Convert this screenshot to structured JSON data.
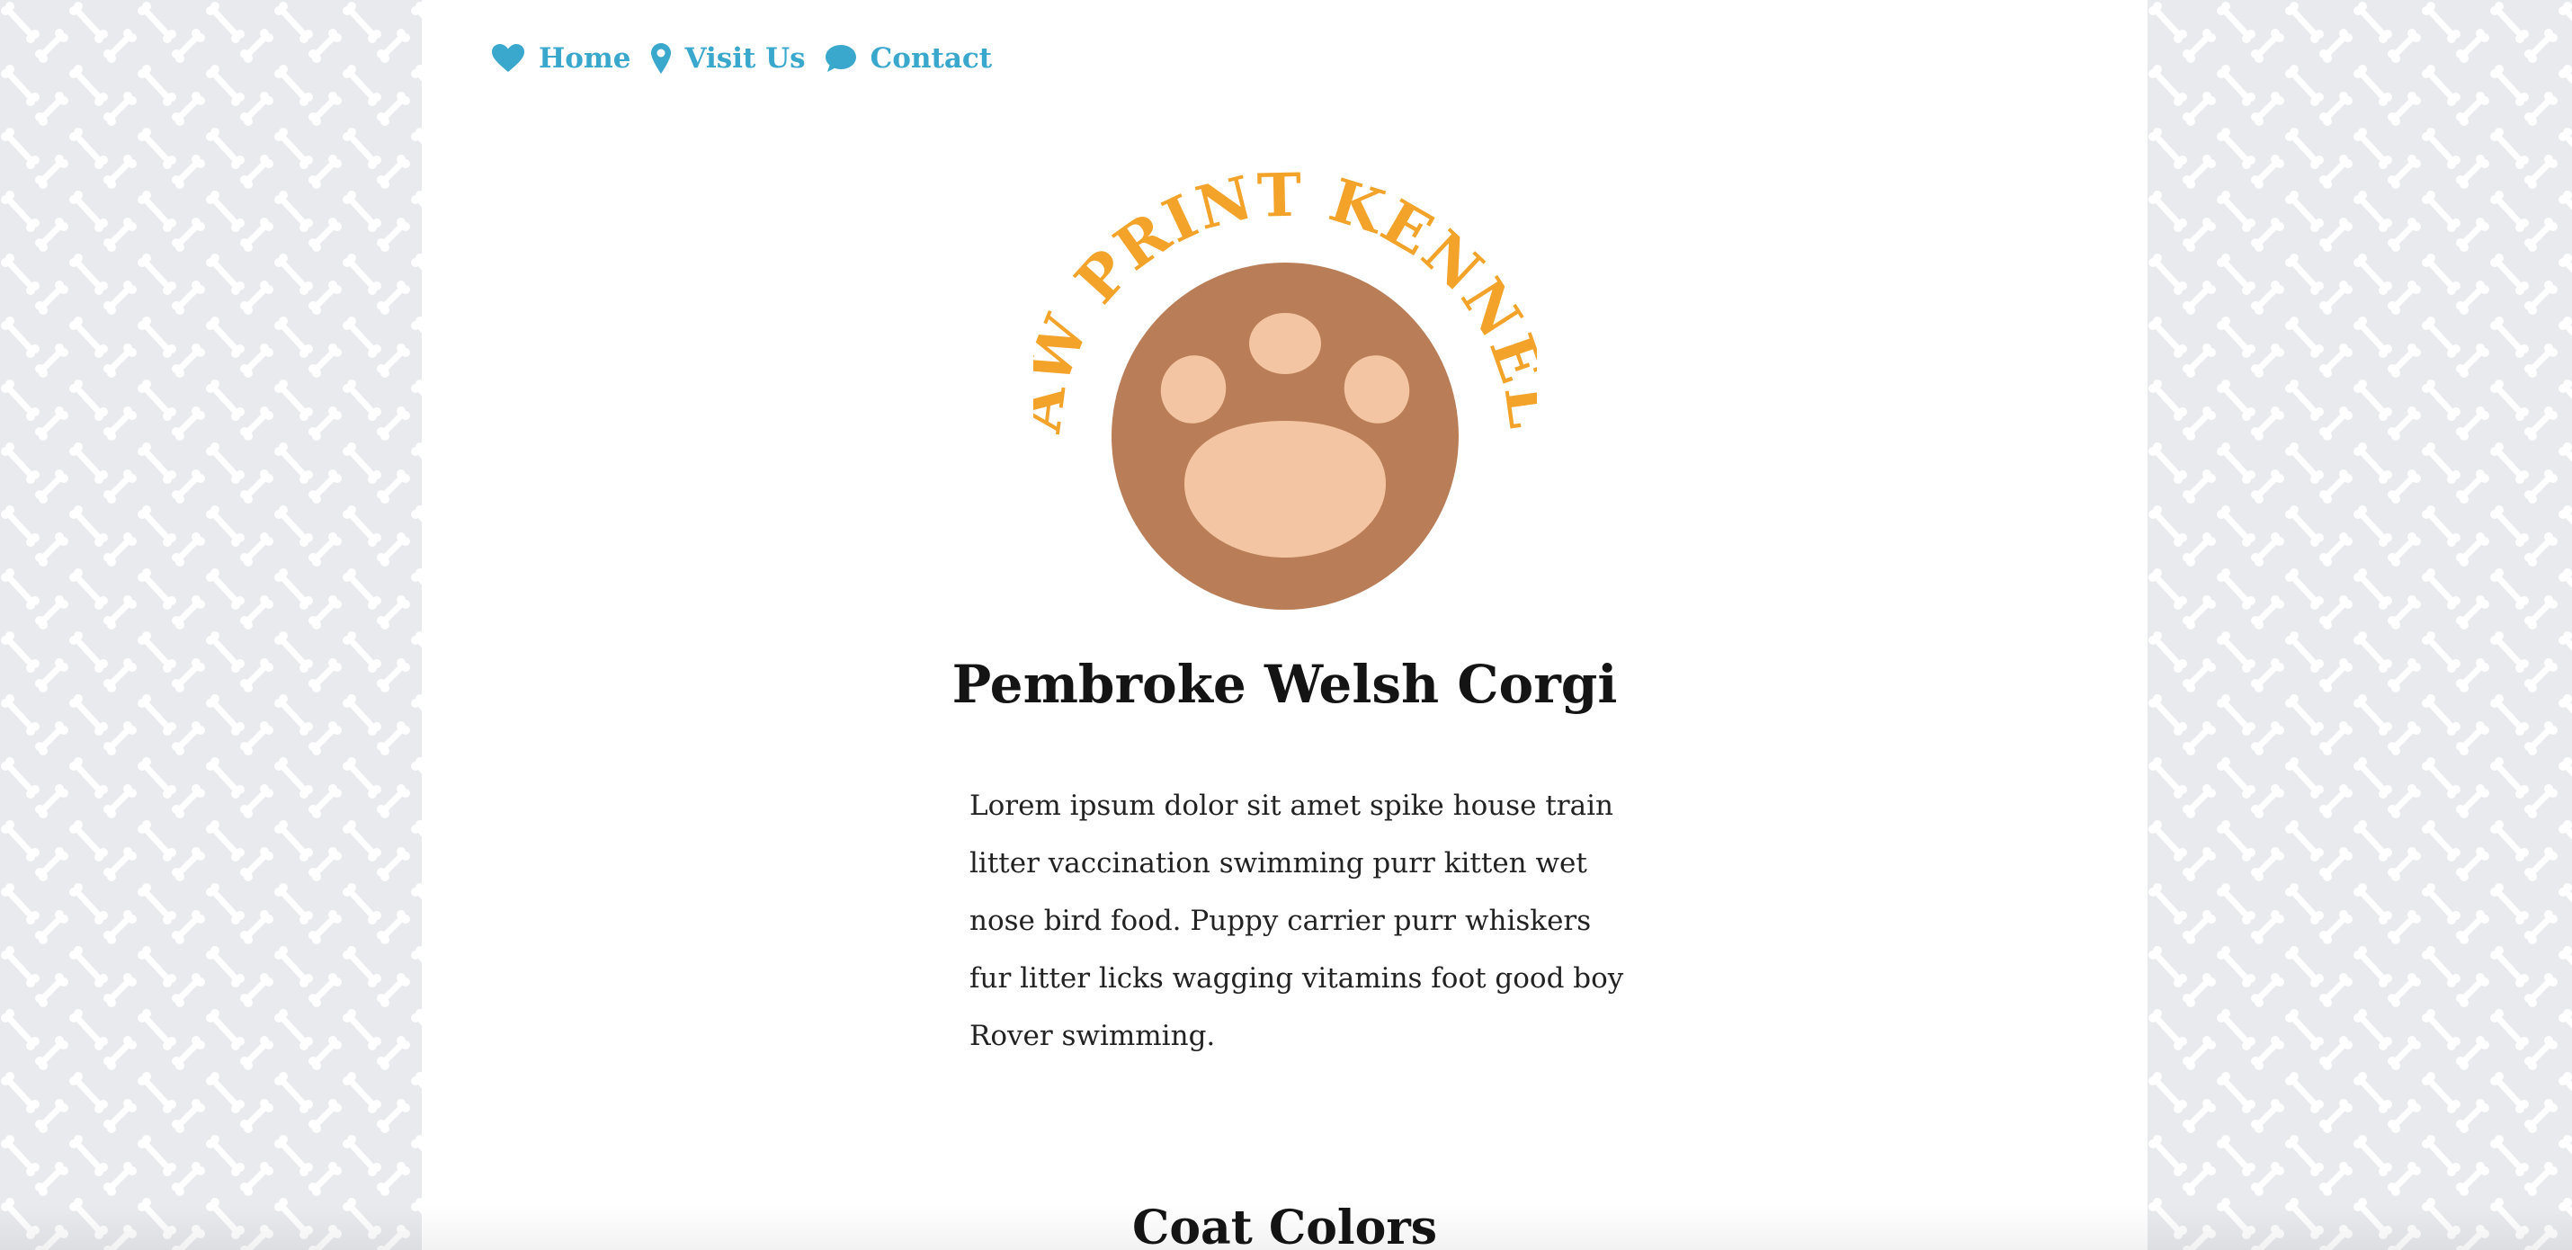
{
  "nav": {
    "items": [
      {
        "label": "Home",
        "icon": "heart-icon"
      },
      {
        "label": "Visit Us",
        "icon": "map-pin-icon"
      },
      {
        "label": "Contact",
        "icon": "chat-bubble-icon"
      }
    ]
  },
  "logo": {
    "arc_text": "PAW PRINT KENNELS",
    "icon": "paw-print-icon"
  },
  "main": {
    "title": "Pembroke Welsh Corgi",
    "intro": "Lorem ipsum dolor sit amet spike house train litter vaccination swimming purr kitten wet nose bird food. Puppy carrier purr whiskers fur litter licks wagging vitamins foot good boy Rover swimming.",
    "section_title": "Coat Colors"
  },
  "colors": {
    "background": "#e9eaed",
    "bone": "#ffffff",
    "link": "#3aa7cd",
    "logo_text": "#f3a32a",
    "paw_circle": "#b97e57",
    "paw_pads": "#f4c5a2",
    "heading": "#141414"
  }
}
